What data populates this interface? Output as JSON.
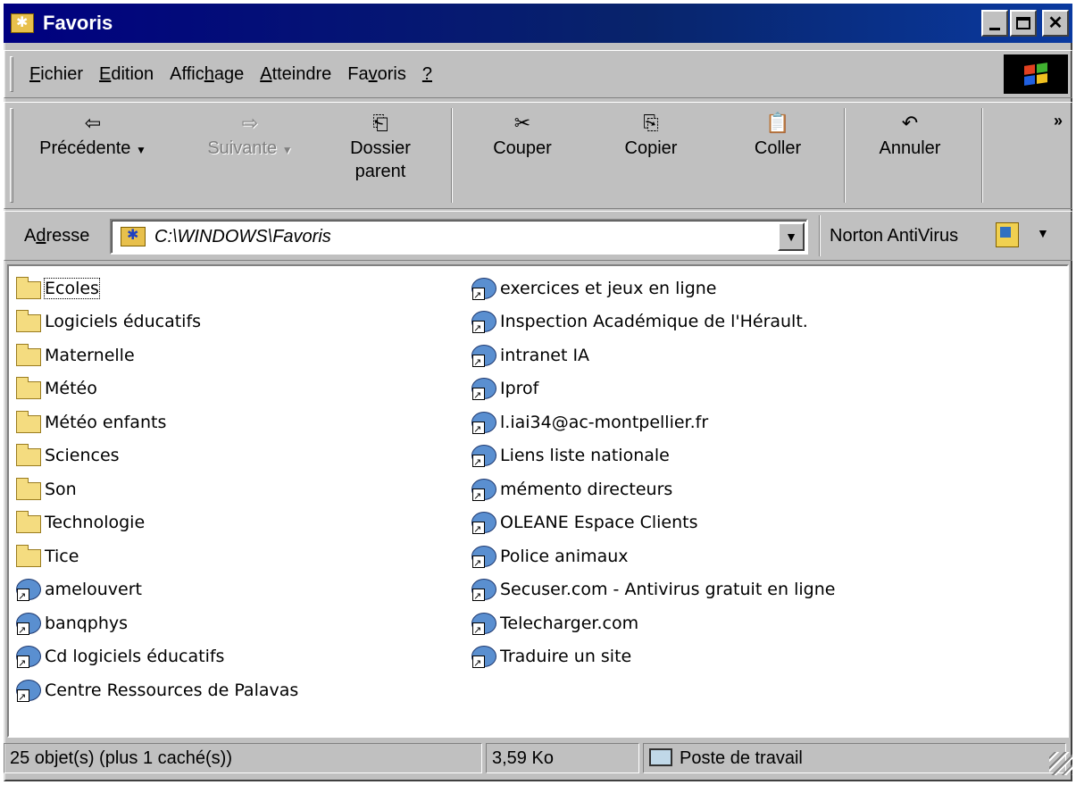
{
  "window": {
    "title": "Favoris"
  },
  "menu": [
    {
      "pre": "",
      "key": "F",
      "post": "ichier"
    },
    {
      "pre": "",
      "key": "E",
      "post": "dition"
    },
    {
      "pre": "Affic",
      "key": "h",
      "post": "age"
    },
    {
      "pre": "",
      "key": "A",
      "post": "tteindre"
    },
    {
      "pre": "Fa",
      "key": "v",
      "post": "oris"
    },
    {
      "pre": "",
      "key": "?",
      "post": ""
    }
  ],
  "toolbar": {
    "back": {
      "label": "Précédente",
      "icon": "back-arrow-icon"
    },
    "forward": {
      "label": "Suivante",
      "icon": "forward-arrow-icon"
    },
    "up_line1": "Dossier",
    "up_line2": "parent",
    "cut": "Couper",
    "copy": "Copier",
    "paste": "Coller",
    "undo": "Annuler",
    "more": "»"
  },
  "address": {
    "label_pre": "A",
    "label_key": "d",
    "label_post": "resse",
    "value": "C:\\WINDOWS\\Favoris",
    "norton": "Norton AntiVirus"
  },
  "items_left": [
    {
      "name": "Ecoles",
      "type": "folder"
    },
    {
      "name": "Logiciels éducatifs",
      "type": "folder"
    },
    {
      "name": "Maternelle",
      "type": "folder"
    },
    {
      "name": "Météo",
      "type": "folder"
    },
    {
      "name": "Météo enfants",
      "type": "folder"
    },
    {
      "name": "Sciences",
      "type": "folder"
    },
    {
      "name": "Son",
      "type": "folder"
    },
    {
      "name": "Technologie",
      "type": "folder"
    },
    {
      "name": "Tice",
      "type": "folder"
    },
    {
      "name": "amelouvert",
      "type": "link"
    },
    {
      "name": "banqphys",
      "type": "link"
    },
    {
      "name": "Cd logiciels éducatifs",
      "type": "link"
    },
    {
      "name": "Centre Ressources de Palavas",
      "type": "link"
    }
  ],
  "items_right": [
    {
      "name": "exercices et jeux en ligne",
      "type": "link"
    },
    {
      "name": "Inspection Académique de l'Hérault.",
      "type": "link"
    },
    {
      "name": "intranet IA",
      "type": "link"
    },
    {
      "name": "Iprof",
      "type": "link"
    },
    {
      "name": "l.iai34@ac-montpellier.fr",
      "type": "link"
    },
    {
      "name": "Liens liste nationale",
      "type": "link"
    },
    {
      "name": "mémento directeurs",
      "type": "link"
    },
    {
      "name": "OLEANE  Espace Clients",
      "type": "link"
    },
    {
      "name": "Police animaux",
      "type": "link"
    },
    {
      "name": "Secuser.com - Antivirus gratuit en ligne",
      "type": "link"
    },
    {
      "name": "Telecharger.com",
      "type": "link"
    },
    {
      "name": "Traduire un site",
      "type": "link"
    }
  ],
  "status": {
    "objects": "25 objet(s) (plus 1 caché(s))",
    "size": "3,59 Ko",
    "zone": "Poste de travail"
  },
  "colors": {
    "titlebar": "#000080",
    "face": "#c0c0c0",
    "folder": "#f4dc80"
  }
}
